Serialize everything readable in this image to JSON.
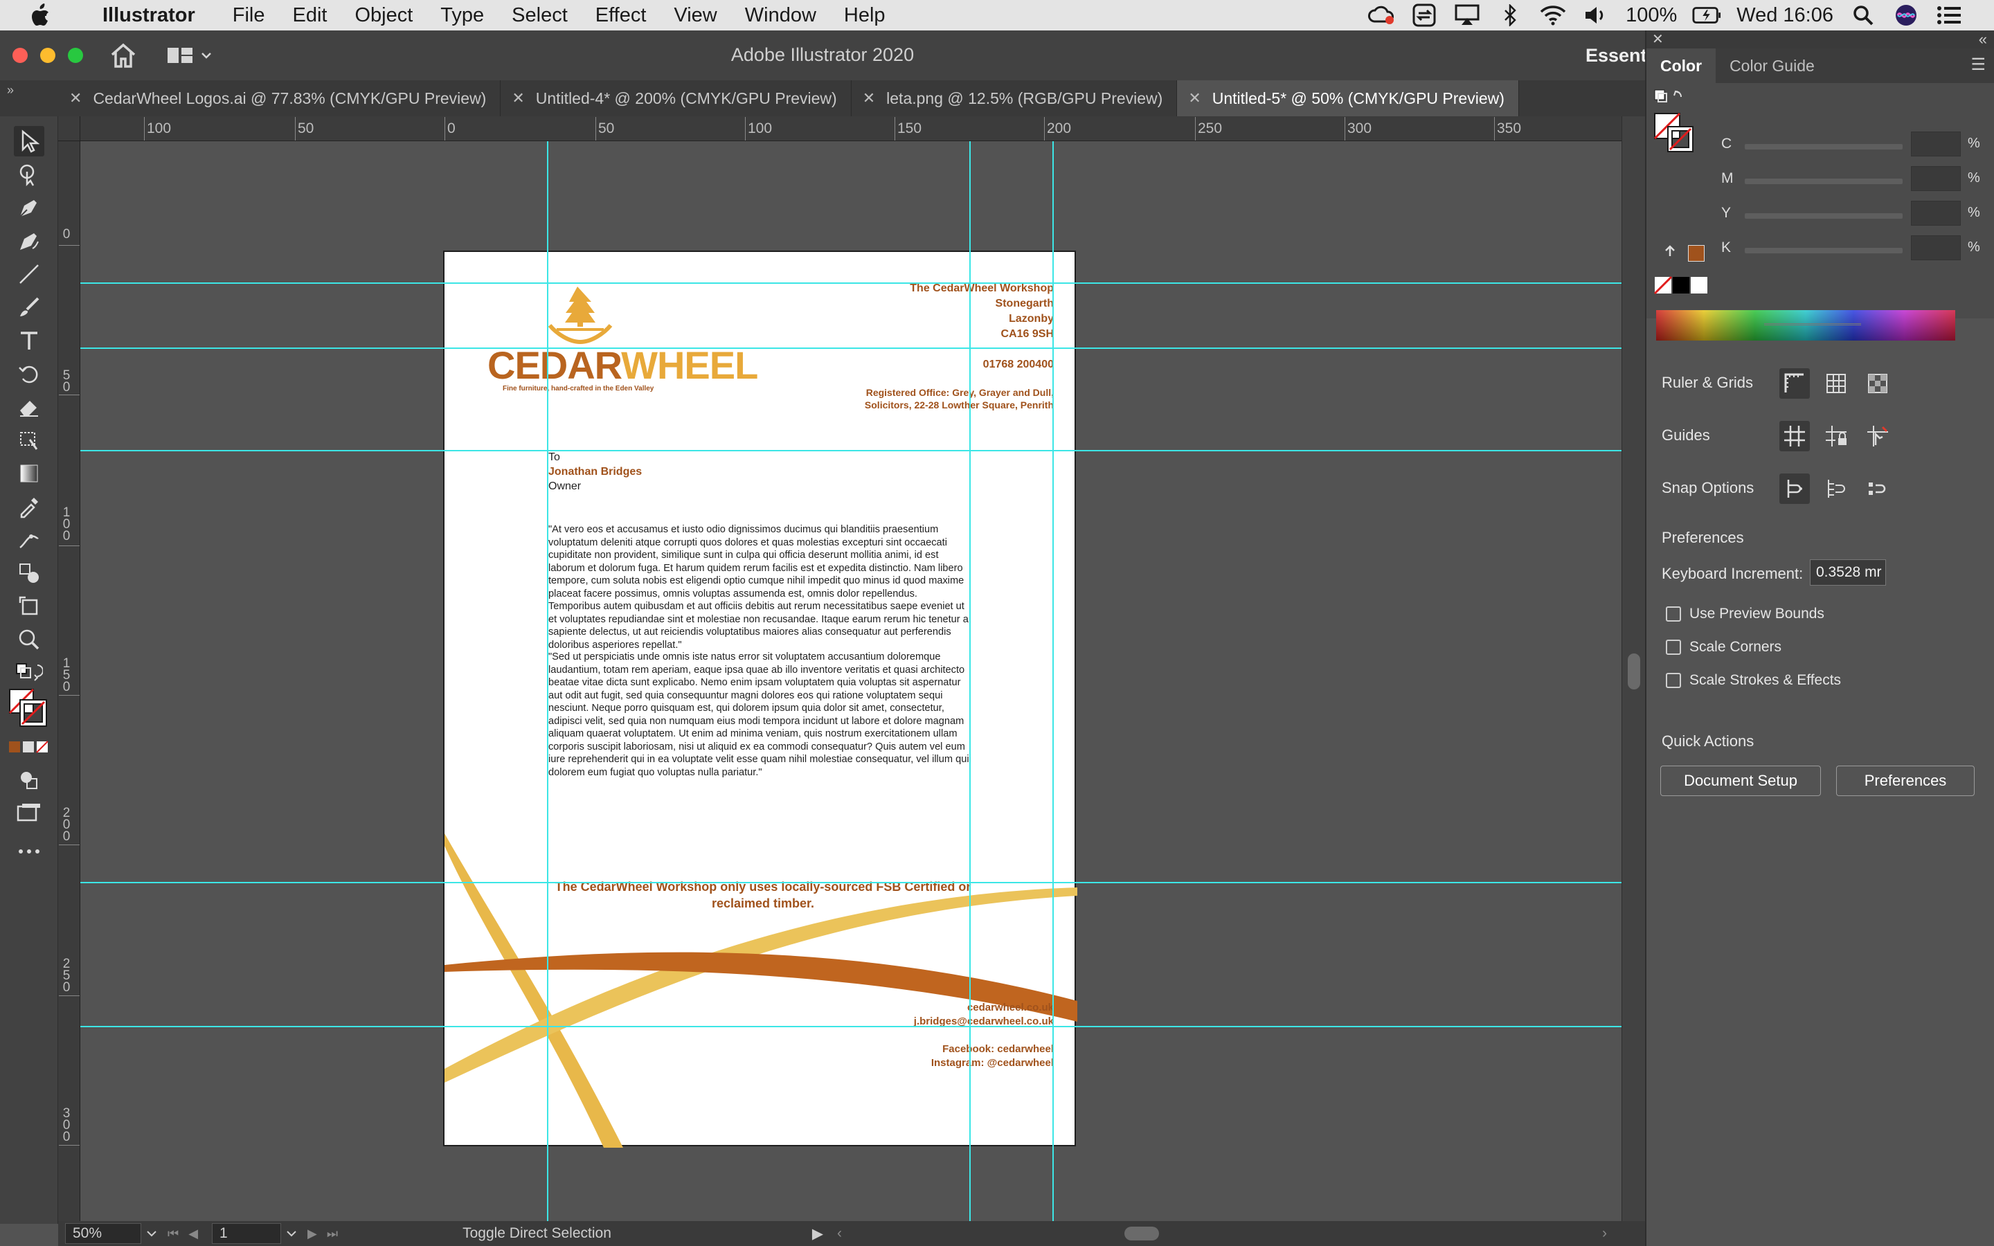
{
  "menubar": {
    "app_name": "Illustrator",
    "items": [
      "File",
      "Edit",
      "Object",
      "Type",
      "Select",
      "Effect",
      "View",
      "Window",
      "Help"
    ],
    "battery": "100%",
    "clock": "Wed 16:06"
  },
  "appbar": {
    "title": "Adobe Illustrator 2020",
    "workspace": "Essentials"
  },
  "tabs": [
    {
      "label": "CedarWheel Logos.ai @ 77.83% (CMYK/GPU Preview)",
      "active": false
    },
    {
      "label": "Untitled-4* @ 200% (CMYK/GPU Preview)",
      "active": false
    },
    {
      "label": "leta.png @ 12.5% (RGB/GPU Preview)",
      "active": false
    },
    {
      "label": "Untitled-5* @ 50% (CMYK/GPU Preview)",
      "active": true
    }
  ],
  "ruler": {
    "h_labels": [
      "100",
      "50",
      "0",
      "50",
      "100",
      "150",
      "200",
      "250",
      "300",
      "350"
    ],
    "v_labels": [
      "0",
      "50",
      "100",
      "150",
      "200",
      "250",
      "300"
    ]
  },
  "document": {
    "address": [
      "The CedarWheel Workshop",
      "Stonegarth",
      "Lazonby",
      "CA16 9SH"
    ],
    "phone": "01768 200400",
    "registered_office": [
      "Registered Office: Grey, Grayer and Dull,",
      "Solicitors, 22-28 Lowther Square, Penrith"
    ],
    "logo_part1": "CEDAR",
    "logo_part2": "WHEEL",
    "logo_tagline": "Fine furniture, hand-crafted in the Eden Valley",
    "to_label": "To",
    "recipient_name": "Jonathan Bridges",
    "recipient_title": "Owner",
    "paragraph1": "\"At vero eos et accusamus et iusto odio dignissimos ducimus qui blanditiis praesentium voluptatum deleniti atque corrupti quos dolores et quas molestias excepturi sint occaecati cupiditate non provident, similique sunt in culpa qui officia deserunt mollitia animi, id est laborum et dolorum fuga. Et harum quidem rerum facilis est et expedita distinctio. Nam libero tempore, cum soluta nobis est eligendi optio cumque nihil impedit quo minus id quod maxime placeat facere possimus, omnis voluptas assumenda est, omnis dolor repellendus. Temporibus autem quibusdam et aut officiis debitis aut rerum necessitatibus saepe eveniet ut et voluptates repudiandae sint et molestiae non recusandae. Itaque earum rerum hic tenetur a sapiente delectus, ut aut reiciendis voluptatibus maiores alias consequatur aut perferendis doloribus asperiores repellat.\"",
    "paragraph2": "\"Sed ut perspiciatis unde omnis iste natus error sit voluptatem accusantium doloremque laudantium, totam rem aperiam, eaque ipsa quae ab illo inventore veritatis et quasi architecto beatae vitae dicta sunt explicabo. Nemo enim ipsam voluptatem quia voluptas sit aspernatur aut odit aut fugit, sed quia consequuntur magni dolores eos qui ratione voluptatem sequi nesciunt. Neque porro quisquam est, qui dolorem ipsum quia dolor sit amet, consectetur, adipisci velit, sed quia non numquam eius modi tempora incidunt ut labore et dolore magnam aliquam quaerat voluptatem. Ut enim ad minima veniam, quis nostrum exercitationem ullam corporis suscipit laboriosam, nisi ut aliquid ex ea commodi consequatur? Quis autem vel eum iure reprehenderit qui in ea voluptate velit esse quam nihil molestiae consequatur, vel illum qui dolorem eum fugiat quo voluptas nulla pariatur.\"",
    "footer_note": "The CedarWheel Workshop only uses locally-sourced FSB Certified or reclaimed timber.",
    "website": "cedarwheel.co.uk",
    "email": "j.bridges@cedarwheel.co.uk",
    "facebook": "Facebook: cedarwheel",
    "instagram": "Instagram: @cedarwheel"
  },
  "status_bar": {
    "zoom": "50%",
    "page": "1",
    "status": "Toggle Direct Selection"
  },
  "panel": {
    "tabs": [
      "Color",
      "Color Guide"
    ],
    "cmyk_labels": [
      "C",
      "M",
      "Y",
      "K"
    ],
    "percent": "%",
    "ruler_grids": "Ruler & Grids",
    "guides": "Guides",
    "snap_options": "Snap Options",
    "preferences_title": "Preferences",
    "keyboard_increment_label": "Keyboard Increment:",
    "keyboard_increment_value": "0.3528 mr",
    "use_preview_bounds": "Use Preview Bounds",
    "scale_corners": "Scale Corners",
    "scale_strokes": "Scale Strokes & Effects",
    "quick_actions": "Quick Actions",
    "document_setup": "Document Setup",
    "preferences_button": "Preferences"
  },
  "colors": {
    "brand_brown": "#a0521c",
    "brand_gold": "#e8b84a",
    "brand_orange": "#c0651f",
    "guide": "#3ce6e6"
  }
}
